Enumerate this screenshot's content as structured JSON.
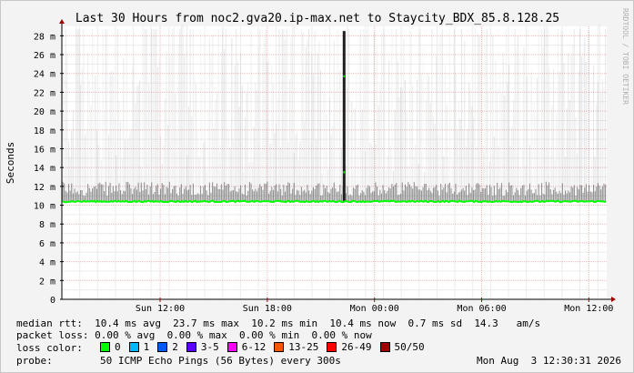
{
  "chart_data": {
    "type": "area",
    "title": "Last 30 Hours from noc2.gva20.ip-max.net to Staycity_BDX_85.8.128.25",
    "ylabel": "Seconds",
    "xlabel": "",
    "ylim": [
      0,
      29
    ],
    "yticks": [
      {
        "value": 0,
        "label": "0"
      },
      {
        "value": 2,
        "label": "2 m"
      },
      {
        "value": 4,
        "label": "4 m"
      },
      {
        "value": 6,
        "label": "6 m"
      },
      {
        "value": 8,
        "label": "8 m"
      },
      {
        "value": 10,
        "label": "10 m"
      },
      {
        "value": 12,
        "label": "12 m"
      },
      {
        "value": 14,
        "label": "14 m"
      },
      {
        "value": 16,
        "label": "16 m"
      },
      {
        "value": 18,
        "label": "18 m"
      },
      {
        "value": 20,
        "label": "20 m"
      },
      {
        "value": 22,
        "label": "22 m"
      },
      {
        "value": 24,
        "label": "24 m"
      },
      {
        "value": 26,
        "label": "26 m"
      },
      {
        "value": 28,
        "label": "28 m"
      }
    ],
    "xrange_hours": [
      -30,
      0.5
    ],
    "xticks": [
      {
        "hour": -24.5,
        "label": "Sun 12:00"
      },
      {
        "hour": -18.5,
        "label": "Sun 18:00"
      },
      {
        "hour": -12.5,
        "label": "Mon 00:00"
      },
      {
        "hour": -6.5,
        "label": "Mon 06:00"
      },
      {
        "hour": -0.5,
        "label": "Mon 12:00"
      }
    ],
    "median_ms": 10.4,
    "max_spike_ms": 28.5,
    "spike_hour": -14.2,
    "grid": true,
    "colors": {
      "median": "#00ff00",
      "smoke": "#6e6e6e",
      "grid_minor": "#ececec",
      "grid_major": "#e2a0a0",
      "axis": "#000000"
    }
  },
  "watermark": "RRDTOOL / TOBI OETIKER",
  "stats": {
    "median_line": "median rtt:  10.4 ms avg  23.7 ms max  10.2 ms min  10.4 ms now  0.7 ms sd  14.3   am/s",
    "loss_line": "packet loss: 0.00 % avg  0.00 % max  0.00 % min  0.00 % now"
  },
  "legend": {
    "title": "loss color:",
    "items": [
      {
        "label": "0",
        "color": "#00ff00"
      },
      {
        "label": "1",
        "color": "#00b8ff"
      },
      {
        "label": "2",
        "color": "#0059ff"
      },
      {
        "label": "3-5",
        "color": "#5e00ff"
      },
      {
        "label": "6-12",
        "color": "#ff00ff"
      },
      {
        "label": "13-25",
        "color": "#ff5500"
      },
      {
        "label": "26-49",
        "color": "#ff0000"
      },
      {
        "label": "50/50",
        "color": "#a10000"
      }
    ]
  },
  "probe": {
    "title": "probe:",
    "description": "50 ICMP Echo Pings (56 Bytes) every 300s",
    "date": "Mon Aug  3 12:30:31 2026"
  }
}
